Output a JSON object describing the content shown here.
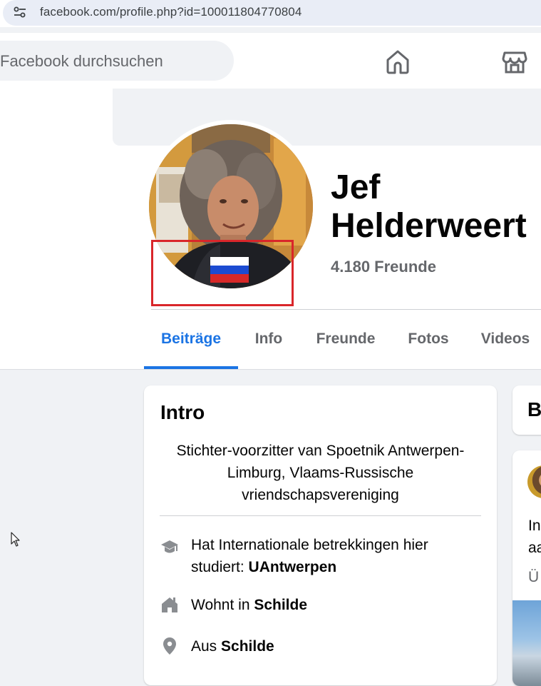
{
  "browser": {
    "url": "facebook.com/profile.php?id=100011804770804",
    "site_icon": "site-settings-icon"
  },
  "topnav": {
    "search_placeholder": "Facebook durchsuchen",
    "icons": [
      "home-icon",
      "marketplace-icon"
    ]
  },
  "profile": {
    "name": "Jef Helderweert",
    "friends": "4.180 Freunde",
    "highlight_color": "#d9262a"
  },
  "tabs": [
    {
      "label": "Beiträge",
      "active": true
    },
    {
      "label": "Info"
    },
    {
      "label": "Freunde"
    },
    {
      "label": "Fotos"
    },
    {
      "label": "Videos"
    }
  ],
  "intro": {
    "title": "Intro",
    "bio": "Stichter-voorzitter van Spoetnik Antwerpen-Limburg, Vlaams-Russische vriendschapsvereniging",
    "education": {
      "prefix": "Hat Internationale betrekkingen hier studiert: ",
      "value": "UAntwerpen",
      "icon": "graduation-cap-icon"
    },
    "lives": {
      "prefix": "Wohnt in ",
      "value": "Schilde",
      "icon": "home-icon"
    },
    "from": {
      "prefix": "Aus ",
      "value": "Schilde",
      "icon": "location-pin-icon"
    }
  },
  "right_column": {
    "card_title_partial": "B",
    "post_text_partial_1": "In",
    "post_text_partial_2": "aa",
    "post_meta_partial": "Ü"
  },
  "colors": {
    "accent": "#1b74e4",
    "secondary_text": "#65676b",
    "page_bg": "#f0f2f5"
  }
}
